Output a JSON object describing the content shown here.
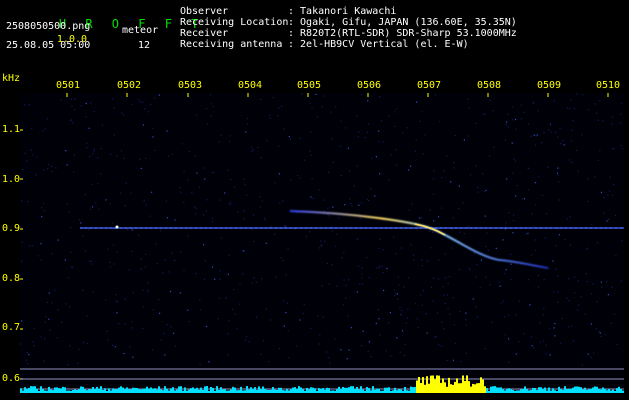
{
  "header": {
    "app_name": "H R O F F T",
    "app_version": "1.0.0",
    "filename": "2508050500.png",
    "datetime": "25.08.05 05:00",
    "meteor_label": "meteor",
    "meteor_count": "12"
  },
  "info": [
    {
      "label": "Observer",
      "value": ": Takanori Kawachi"
    },
    {
      "label": "Receiving Location",
      "value": ": Ogaki, Gifu, JAPAN (136.60E, 35.35N)"
    },
    {
      "label": "Receiver",
      "value": ": R820T2(RTL-SDR) SDR-Sharp 53.1000MHz"
    },
    {
      "label": "Receiving antenna",
      "value": ": 2el-HB9CV Vertical (el. E-W)"
    }
  ],
  "axis": {
    "y_unit": "kHz",
    "time_ticks": [
      "0501",
      "0502",
      "0503",
      "0504",
      "0505",
      "0506",
      "0507",
      "0508",
      "0509",
      "0510"
    ],
    "freq_ticks": [
      "1.1",
      "1.0",
      "0.9",
      "0.8",
      "0.7",
      "0.6"
    ]
  },
  "colors": {
    "brand": "#00e000",
    "version": "#ffff00",
    "axis_label": "#ffff00",
    "background": "#000008",
    "carrier": "#4060ff",
    "trail_hot": "#ffe060",
    "noise_floor": "#00e0ff",
    "noise_peak": "#ffff00"
  }
}
